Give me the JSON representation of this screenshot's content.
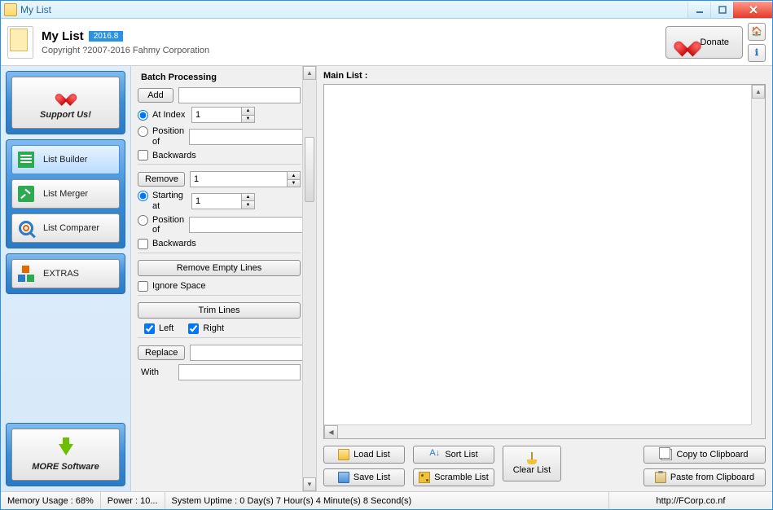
{
  "window": {
    "title": "My List"
  },
  "header": {
    "app_name": "My List",
    "version": "2016.8",
    "copyright": "Copyright ?2007-2016 Fahmy Corporation",
    "donate": "Donate"
  },
  "sidebar": {
    "support": "Support Us!",
    "items": [
      "List Builder",
      "List Merger",
      "List Comparer"
    ],
    "extras": "EXTRAS",
    "more": "MORE Software"
  },
  "batch": {
    "title": "Batch Processing",
    "add": "Add",
    "at_index": "At Index",
    "at_index_val": "1",
    "position_of": "Position of",
    "backwards": "Backwards",
    "remove": "Remove",
    "remove_val": "1",
    "starting_at": "Starting at",
    "starting_at_val": "1",
    "remove_empty": "Remove Empty Lines",
    "ignore_space": "Ignore Space",
    "trim_lines": "Trim Lines",
    "left": "Left",
    "right": "Right",
    "replace": "Replace",
    "with": "With"
  },
  "main": {
    "title": "Main List :",
    "load": "Load List",
    "save": "Save List",
    "sort": "Sort List",
    "scramble": "Scramble List",
    "clear": "Clear List",
    "copy": "Copy to Clipboard",
    "paste": "Paste from Clipboard"
  },
  "status": {
    "memory": "Memory Usage : 68%",
    "power": "Power : 10...",
    "uptime": "System Uptime : 0 Day(s) 7 Hour(s) 4 Minute(s) 8 Second(s)",
    "url": "http://FCorp.co.nf"
  }
}
